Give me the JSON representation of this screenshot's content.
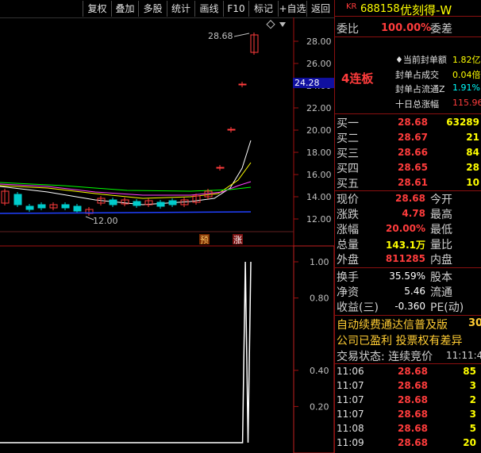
{
  "toolbar": {
    "items": [
      "复权",
      "叠加",
      "多股",
      "统计",
      "画线",
      "F10",
      "标记",
      "+自选",
      "返回"
    ]
  },
  "main_chart": {
    "y_ticks": [
      "28.00",
      "26.00",
      "24.00",
      "22.00",
      "20.00",
      "18.00",
      "16.00",
      "14.00",
      "12.00"
    ],
    "current_price_label": "24.28",
    "high_annotation": "28.68",
    "low_annotation": "12.00",
    "marker_yu": "预",
    "marker_zhang": "涨"
  },
  "sub_chart": {
    "y_ticks": [
      "1.00",
      "0.80",
      "0.40",
      "0.20"
    ],
    "series": [
      0,
      0,
      0,
      0,
      0,
      0,
      0,
      0,
      0,
      0,
      0,
      0,
      0,
      0,
      0,
      0,
      0,
      0,
      0,
      0,
      0,
      0,
      0,
      0,
      0,
      0,
      0,
      0,
      0,
      0,
      0,
      0,
      0,
      0,
      0,
      0,
      0,
      0,
      0,
      0,
      0,
      0,
      0,
      0,
      0,
      0,
      0,
      0,
      0,
      0,
      0,
      0,
      0,
      0,
      0,
      0,
      0,
      0,
      0,
      0,
      0,
      0,
      0,
      0,
      0,
      0,
      0,
      0,
      0,
      0,
      0,
      0,
      0,
      0,
      0,
      0,
      0,
      0,
      0,
      0,
      0,
      0,
      0,
      0,
      0,
      0,
      0,
      0,
      0,
      1,
      0,
      1
    ]
  },
  "quote": {
    "prefix": "KR",
    "code": "688158",
    "name": "优刻得-W",
    "weibi_label": "委比",
    "weibi_value": "100.00%",
    "weicha_label": "委差",
    "lianban": "4连板",
    "seal_rows": [
      {
        "label": "当前封单额",
        "value": "1.82亿"
      },
      {
        "label": "封单占成交",
        "value": "0.04倍"
      },
      {
        "label": "封单占流通Z",
        "value": "1.91%"
      },
      {
        "label": "十日总涨幅",
        "value": "115.96"
      }
    ],
    "bids": [
      {
        "label": "买一",
        "price": "28.68",
        "vol": "63289"
      },
      {
        "label": "买二",
        "price": "28.67",
        "vol": "21"
      },
      {
        "label": "买三",
        "price": "28.66",
        "vol": "84"
      },
      {
        "label": "买四",
        "price": "28.65",
        "vol": "28"
      },
      {
        "label": "买五",
        "price": "28.61",
        "vol": "10"
      }
    ],
    "stats": [
      {
        "l1": "现价",
        "v1": "28.68",
        "l2": "今开"
      },
      {
        "l1": "涨跌",
        "v1": "4.78",
        "l2": "最高"
      },
      {
        "l1": "涨幅",
        "v1": "20.00%",
        "l2": "最低"
      },
      {
        "l1": "总量",
        "v1": "143.1万",
        "l2": "量比"
      },
      {
        "l1": "外盘",
        "v1": "811285",
        "l2": "内盘"
      }
    ],
    "stats2": [
      {
        "l1": "换手",
        "v1": "35.59%",
        "l2": "股本"
      },
      {
        "l1": "净资",
        "v1": "5.46",
        "l2": "流通"
      },
      {
        "l1": "收益(三)",
        "v1": "-0.360",
        "l2": "PE(动)"
      }
    ],
    "info1": "自动续费通达信普及版",
    "info1_num": "30",
    "info2": "公司已盈利 投票权有差异",
    "trade_status": "交易状态: 连续竞价",
    "trade_time": "11:11:4",
    "ticks": [
      {
        "time": "11:06",
        "price": "28.68",
        "vol": "85"
      },
      {
        "time": "11:07",
        "price": "28.68",
        "vol": "3"
      },
      {
        "time": "11:07",
        "price": "28.68",
        "vol": "2"
      },
      {
        "time": "11:07",
        "price": "28.68",
        "vol": "3"
      },
      {
        "time": "11:08",
        "price": "28.68",
        "vol": "5"
      },
      {
        "time": "11:09",
        "price": "28.68",
        "vol": "20"
      }
    ]
  }
}
